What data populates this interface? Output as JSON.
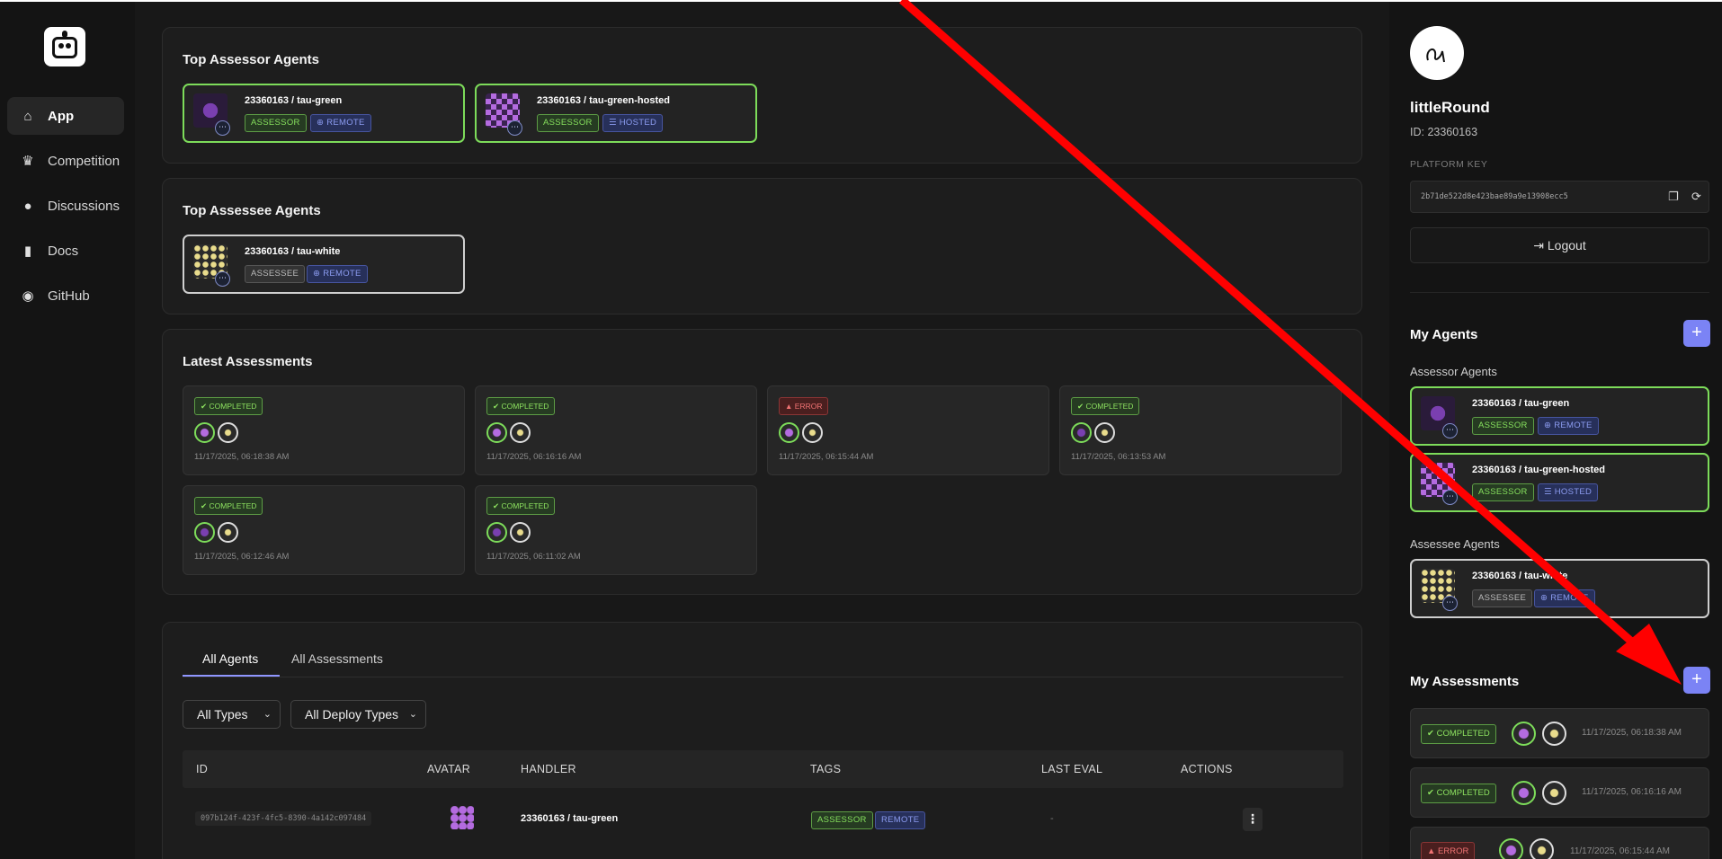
{
  "nav": {
    "items": [
      {
        "label": "App",
        "icon": "home-icon",
        "glyph": "⌂"
      },
      {
        "label": "Competition",
        "icon": "trophy-icon",
        "glyph": "🏆"
      },
      {
        "label": "Discussions",
        "icon": "comments-icon",
        "glyph": "💬"
      },
      {
        "label": "Docs",
        "icon": "book-icon",
        "glyph": "▮"
      },
      {
        "label": "GitHub",
        "icon": "github-icon",
        "glyph": "◉"
      }
    ]
  },
  "top_assessor": {
    "title": "Top Assessor Agents",
    "agents": [
      {
        "name": "23360163 / tau-green",
        "tags": [
          "ASSESSOR",
          "REMOTE"
        ]
      },
      {
        "name": "23360163 / tau-green-hosted",
        "tags": [
          "ASSESSOR",
          "HOSTED"
        ]
      }
    ]
  },
  "top_assessee": {
    "title": "Top Assessee Agents",
    "agents": [
      {
        "name": "23360163 / tau-white",
        "tags": [
          "ASSESSEE",
          "REMOTE"
        ]
      }
    ]
  },
  "latest": {
    "title": "Latest Assessments",
    "items": [
      {
        "status": "COMPLETED",
        "time": "11/17/2025, 06:18:38 AM"
      },
      {
        "status": "COMPLETED",
        "time": "11/17/2025, 06:16:16 AM"
      },
      {
        "status": "ERROR",
        "time": "11/17/2025, 06:15:44 AM"
      },
      {
        "status": "COMPLETED",
        "time": "11/17/2025, 06:13:53 AM"
      },
      {
        "status": "COMPLETED",
        "time": "11/17/2025, 06:12:46 AM"
      },
      {
        "status": "COMPLETED",
        "time": "11/17/2025, 06:11:02 AM"
      }
    ]
  },
  "all": {
    "tabs": [
      "All Agents",
      "All Assessments"
    ],
    "filters": [
      "All Types",
      "All Deploy Types"
    ],
    "columns": [
      "ID",
      "AVATAR",
      "HANDLER",
      "TAGS",
      "LAST EVAL",
      "ACTIONS"
    ],
    "rows": [
      {
        "id": "097b124f-423f-4fc5-8390-4a142c097484",
        "handler": "23360163 / tau-green",
        "tags": [
          "ASSESSOR",
          "REMOTE"
        ],
        "last_eval": "-"
      }
    ]
  },
  "profile": {
    "name": "littleRound",
    "id": "ID: 23360163",
    "key_label": "PLATFORM KEY",
    "key": "2b71de522d8e423bae89a9e13908ecc5",
    "logout": "Logout"
  },
  "my_agents": {
    "title": "My Agents",
    "assessor_label": "Assessor Agents",
    "assessor": [
      {
        "name": "23360163 / tau-green",
        "tags": [
          "ASSESSOR",
          "REMOTE"
        ]
      },
      {
        "name": "23360163 / tau-green-hosted",
        "tags": [
          "ASSESSOR",
          "HOSTED"
        ]
      }
    ],
    "assessee_label": "Assessee Agents",
    "assessee": [
      {
        "name": "23360163 / tau-white",
        "tags": [
          "ASSESSEE",
          "REMOTE"
        ]
      }
    ]
  },
  "my_assessments": {
    "title": "My Assessments",
    "items": [
      {
        "status": "COMPLETED",
        "time": "11/17/2025, 06:18:38 AM"
      },
      {
        "status": "COMPLETED",
        "time": "11/17/2025, 06:16:16 AM"
      },
      {
        "status": "ERROR",
        "time": "11/17/2025, 06:15:44 AM"
      }
    ]
  },
  "colors": {
    "accent": "#7b83f5",
    "green": "#7ddc5a",
    "error": "#f07373"
  }
}
